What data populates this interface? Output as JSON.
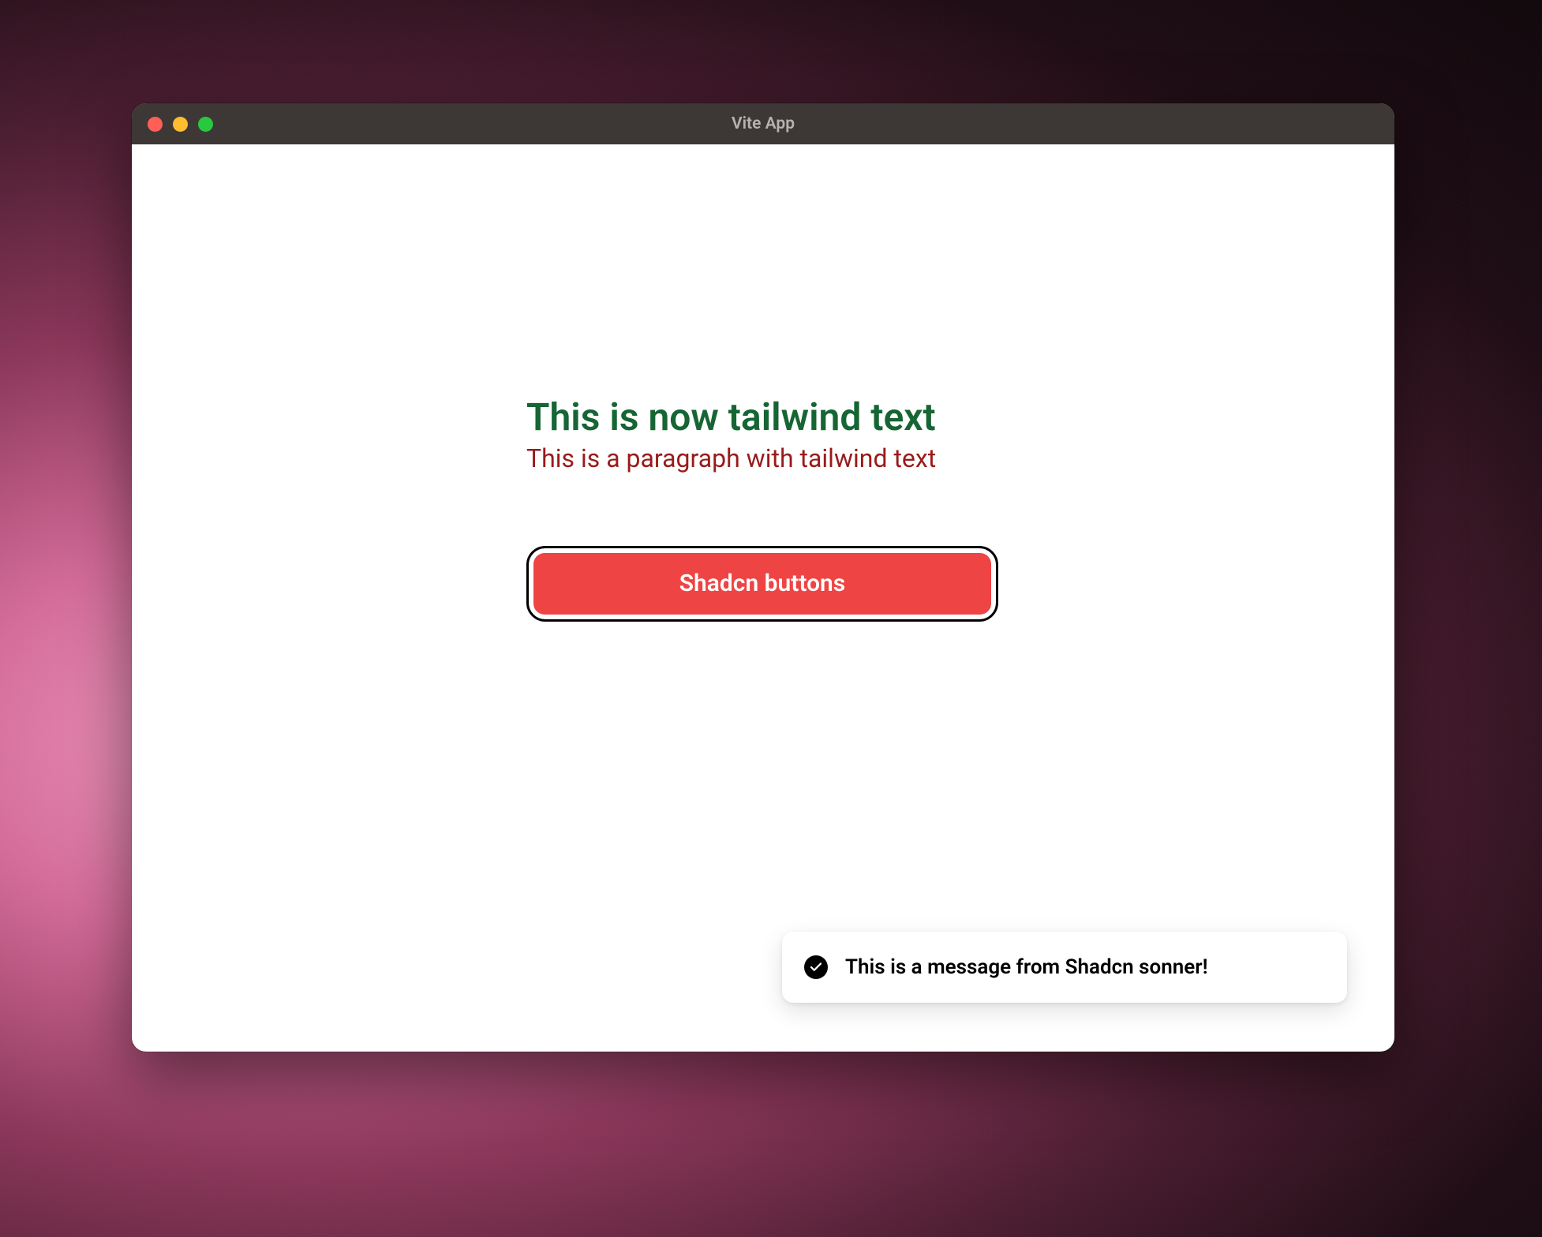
{
  "window": {
    "title": "Vite App"
  },
  "content": {
    "heading": "This is now tailwind text",
    "paragraph": "This is a paragraph with tailwind text",
    "button_label": "Shadcn buttons"
  },
  "toast": {
    "message": "This is a message from Shadcn sonner!",
    "icon": "check-circle-icon"
  },
  "colors": {
    "heading": "#166534",
    "paragraph": "#991b1b",
    "button_bg": "#ef4444",
    "button_text": "#ffffff"
  }
}
